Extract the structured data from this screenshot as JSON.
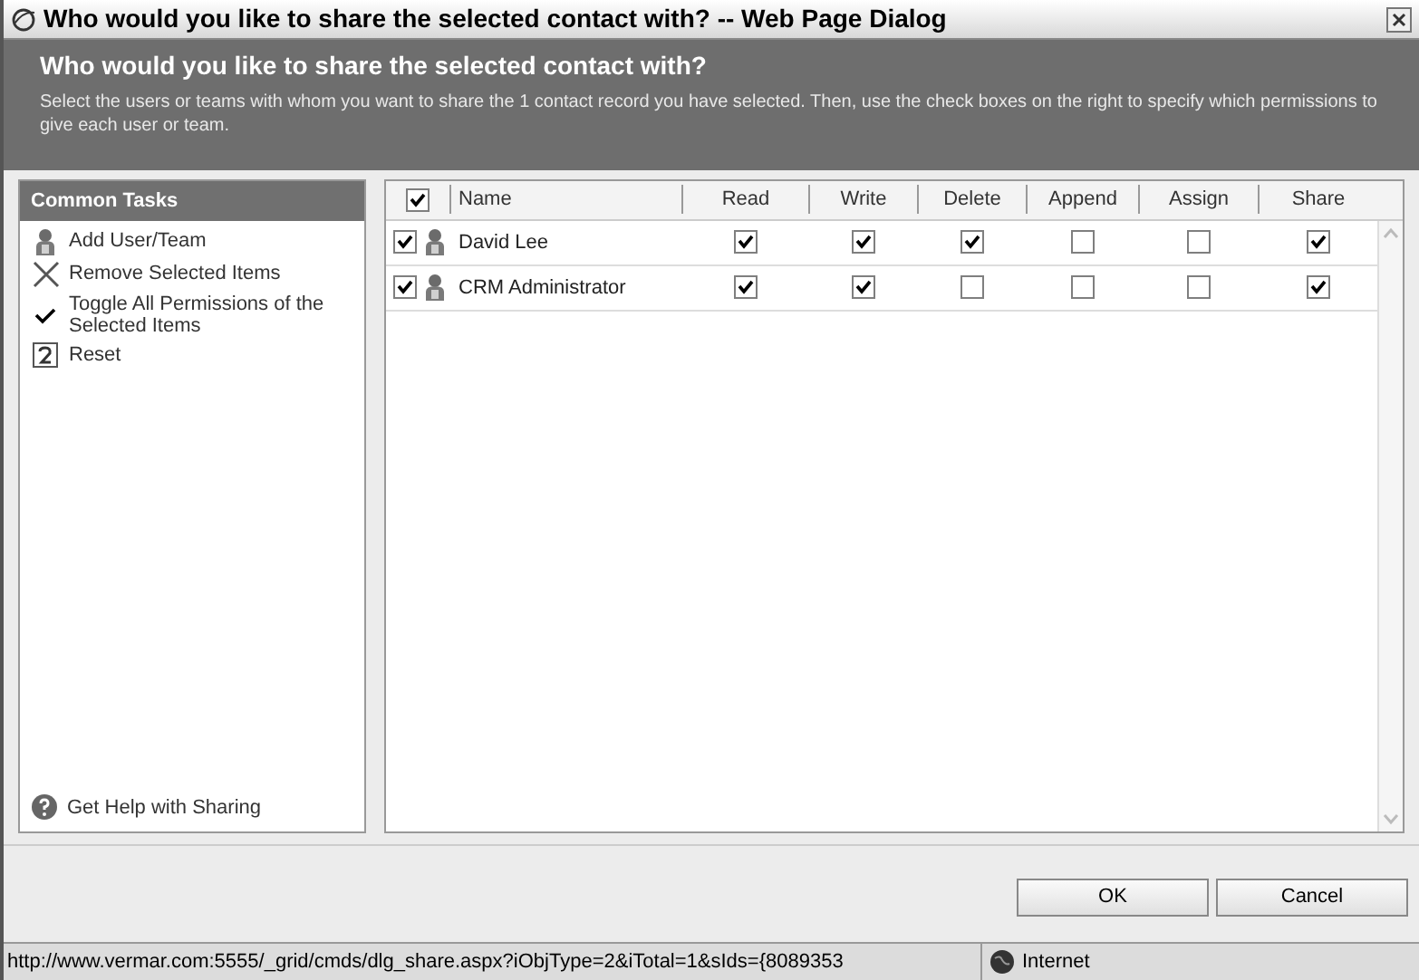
{
  "window": {
    "title": "Who would you like to share the selected contact with? -- Web Page Dialog"
  },
  "header": {
    "title": "Who would you like to share the selected contact with?",
    "description": "Select the users or teams with whom you want to share the 1 contact record you have selected. Then, use the check boxes on the right to specify which permissions to give each user or team."
  },
  "tasks": {
    "title": "Common Tasks",
    "items": [
      {
        "kind": "user",
        "label": "Add User/Team"
      },
      {
        "kind": "remove",
        "label": "Remove Selected Items"
      },
      {
        "kind": "toggle",
        "label": "Toggle All Permissions of the Selected Items"
      },
      {
        "kind": "reset",
        "label": "Reset"
      }
    ],
    "help": "Get Help with Sharing"
  },
  "grid": {
    "select_all_checked": true,
    "columns": [
      "Name",
      "Read",
      "Write",
      "Delete",
      "Append",
      "Assign",
      "Share"
    ],
    "rows": [
      {
        "checked": true,
        "name": "David Lee",
        "permissions": [
          {
            "checked": true
          },
          {
            "checked": true
          },
          {
            "checked": true
          },
          {
            "checked": false
          },
          {
            "checked": false
          },
          {
            "checked": true
          }
        ]
      },
      {
        "checked": true,
        "name": "CRM Administrator",
        "permissions": [
          {
            "checked": true
          },
          {
            "checked": true
          },
          {
            "checked": false
          },
          {
            "checked": false
          },
          {
            "checked": false
          },
          {
            "checked": true
          }
        ]
      }
    ]
  },
  "buttons": [
    "OK",
    "Cancel"
  ],
  "status_bar": {
    "url": "http://www.vermar.com:5555/_grid/cmds/dlg_share.aspx?iObjType=2&iTotal=1&sIds={8089353",
    "zone": "Internet"
  }
}
